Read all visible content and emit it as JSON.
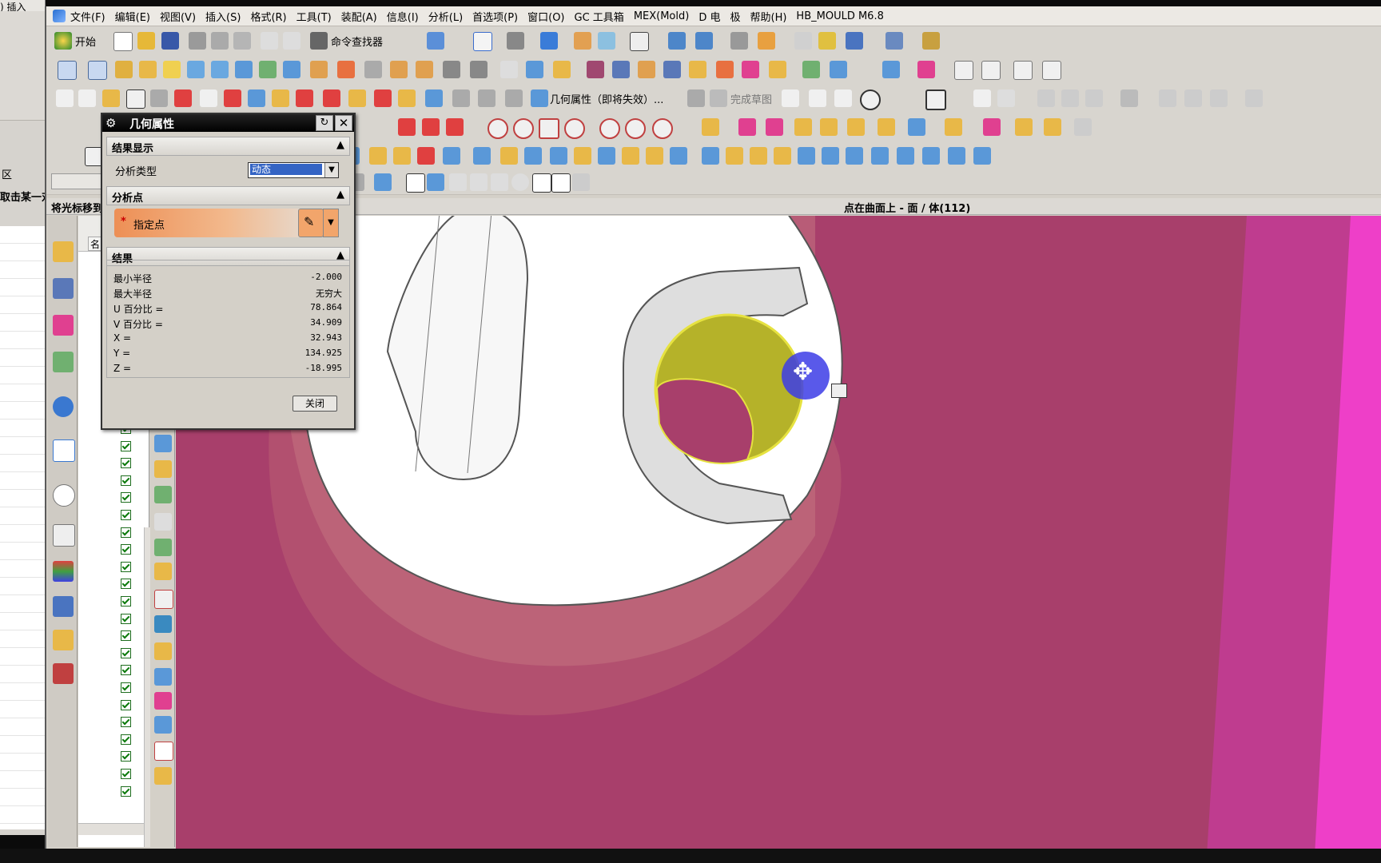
{
  "bg_window": {
    "menu_snip": ")  插入",
    "label_snip": "区",
    "hint_snip": "取击某一对"
  },
  "menubar": {
    "items": [
      "文件(F)",
      "编辑(E)",
      "视图(V)",
      "插入(S)",
      "格式(R)",
      "工具(T)",
      "装配(A)",
      "信息(I)",
      "分析(L)",
      "首选项(P)",
      "窗口(O)",
      "GC 工具箱",
      "MEX(Mold)",
      "D 电",
      "极",
      "帮助(H)",
      "HB_MOULD M6.8"
    ]
  },
  "toolbar": {
    "start_label": "开始",
    "cmd_finder_label": "命令查找器",
    "geom_props_label": "几何属性（即将失效）...",
    "finish_sketch_label": "完成草图"
  },
  "status": {
    "left": "将光标移到",
    "right": "点在曲面上 - 面 / 体(112)"
  },
  "navigator": {
    "col_header": "名"
  },
  "dialog": {
    "title": "几何属性",
    "sections": {
      "display": "结果显示",
      "point": "分析点",
      "results": "结果"
    },
    "analysis_type_label": "分析类型",
    "analysis_type_value": "动态",
    "specify_point_label": "指定点",
    "results": [
      {
        "k": "最小半径",
        "v": "-2.000"
      },
      {
        "k": "最大半径",
        "v": "无穷大"
      },
      {
        "k": "U 百分比 =",
        "v": "78.864"
      },
      {
        "k": "V 百分比 =",
        "v": "34.909"
      },
      {
        "k": "X =",
        "v": "32.943"
      },
      {
        "k": "Y =",
        "v": "134.925"
      },
      {
        "k": "Z =",
        "v": "-18.995"
      }
    ],
    "close_label": "关闭"
  },
  "colors": {
    "background_magenta": "#a83f6b",
    "hole_yellow": "#c9c62e",
    "selection_orange": "#ed8f55",
    "selection_blue": "#3464c4"
  }
}
